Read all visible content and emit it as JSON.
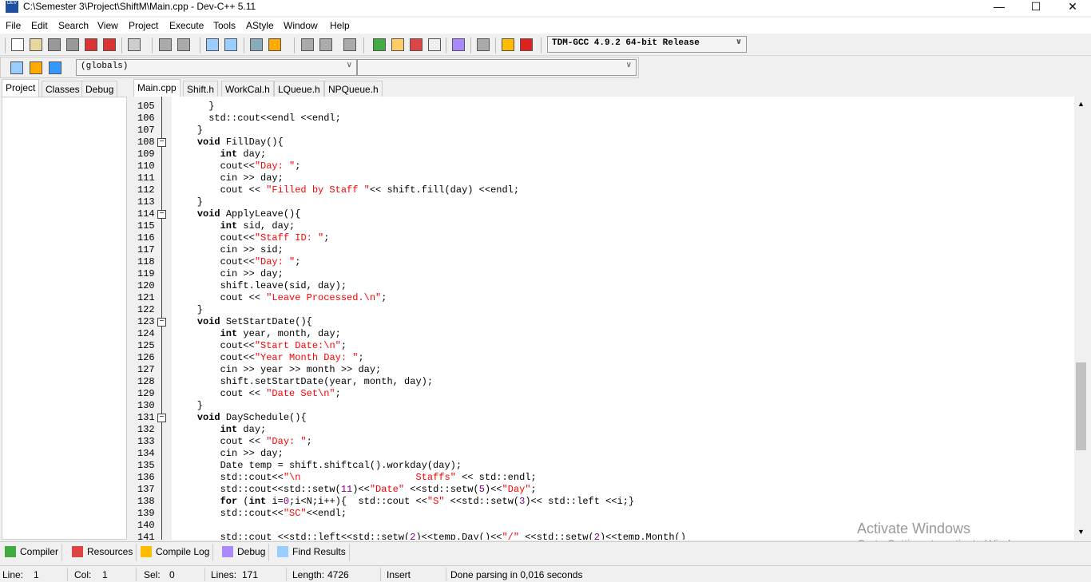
{
  "window": {
    "title": "C:\\Semester 3\\Project\\ShiftM\\Main.cpp - Dev-C++ 5.11",
    "icon_text": "DEV",
    "minimize": "—",
    "maximize": "☐",
    "close": "✕"
  },
  "menu": [
    "File",
    "Edit",
    "Search",
    "View",
    "Project",
    "Execute",
    "Tools",
    "AStyle",
    "Window",
    "Help"
  ],
  "toolbar": {
    "compiler_select": "TDM-GCC 4.9.2 64-bit Release",
    "scope_select": "(globals)",
    "member_select": ""
  },
  "left_tabs": [
    "Project",
    "Classes",
    "Debug"
  ],
  "file_tabs": [
    "Main.cpp",
    "Shift.h",
    "WorkCal.h",
    "LQueue.h",
    "NPQueue.h"
  ],
  "editor": {
    "first_line": 105,
    "fold_lines": [
      108,
      114,
      123,
      131
    ],
    "lines": [
      [
        [
          "t",
          "      }"
        ]
      ],
      [
        [
          "t",
          "      std::cout<<endl <<endl;"
        ]
      ],
      [
        [
          "t",
          "    }"
        ]
      ],
      [
        [
          "t",
          "    "
        ],
        [
          "kw",
          "void"
        ],
        [
          "t",
          " FillDay(){"
        ]
      ],
      [
        [
          "t",
          "        "
        ],
        [
          "kw",
          "int"
        ],
        [
          "t",
          " day;"
        ]
      ],
      [
        [
          "t",
          "        cout<<"
        ],
        [
          "str",
          "\"Day: \""
        ],
        [
          "t",
          ";"
        ]
      ],
      [
        [
          "t",
          "        cin >> day;"
        ]
      ],
      [
        [
          "t",
          "        cout << "
        ],
        [
          "str",
          "\"Filled by Staff \""
        ],
        [
          "t",
          "<< shift.fill(day) <<endl;"
        ]
      ],
      [
        [
          "t",
          "    }"
        ]
      ],
      [
        [
          "t",
          "    "
        ],
        [
          "kw",
          "void"
        ],
        [
          "t",
          " ApplyLeave(){"
        ]
      ],
      [
        [
          "t",
          "        "
        ],
        [
          "kw",
          "int"
        ],
        [
          "t",
          " sid, day;"
        ]
      ],
      [
        [
          "t",
          "        cout<<"
        ],
        [
          "str",
          "\"Staff ID: \""
        ],
        [
          "t",
          ";"
        ]
      ],
      [
        [
          "t",
          "        cin >> sid;"
        ]
      ],
      [
        [
          "t",
          "        cout<<"
        ],
        [
          "str",
          "\"Day: \""
        ],
        [
          "t",
          ";"
        ]
      ],
      [
        [
          "t",
          "        cin >> day;"
        ]
      ],
      [
        [
          "t",
          "        shift.leave(sid, day);"
        ]
      ],
      [
        [
          "t",
          "        cout << "
        ],
        [
          "str",
          "\"Leave Processed.\\n\""
        ],
        [
          "t",
          ";"
        ]
      ],
      [
        [
          "t",
          "    }"
        ]
      ],
      [
        [
          "t",
          "    "
        ],
        [
          "kw",
          "void"
        ],
        [
          "t",
          " SetStartDate(){"
        ]
      ],
      [
        [
          "t",
          "        "
        ],
        [
          "kw",
          "int"
        ],
        [
          "t",
          " year, month, day;"
        ]
      ],
      [
        [
          "t",
          "        cout<<"
        ],
        [
          "str",
          "\"Start Date:\\n\""
        ],
        [
          "t",
          ";"
        ]
      ],
      [
        [
          "t",
          "        cout<<"
        ],
        [
          "str",
          "\"Year Month Day: \""
        ],
        [
          "t",
          ";"
        ]
      ],
      [
        [
          "t",
          "        cin >> year >> month >> day;"
        ]
      ],
      [
        [
          "t",
          "        shift.setStartDate(year, month, day);"
        ]
      ],
      [
        [
          "t",
          "        cout << "
        ],
        [
          "str",
          "\"Date Set\\n\""
        ],
        [
          "t",
          ";"
        ]
      ],
      [
        [
          "t",
          "    }"
        ]
      ],
      [
        [
          "t",
          "    "
        ],
        [
          "kw",
          "void"
        ],
        [
          "t",
          " DaySchedule(){"
        ]
      ],
      [
        [
          "t",
          "        "
        ],
        [
          "kw",
          "int"
        ],
        [
          "t",
          " day;"
        ]
      ],
      [
        [
          "t",
          "        cout << "
        ],
        [
          "str",
          "\"Day: \""
        ],
        [
          "t",
          ";"
        ]
      ],
      [
        [
          "t",
          "        cin >> day;"
        ]
      ],
      [
        [
          "t",
          "        Date temp = shift.shiftcal().workday(day);"
        ]
      ],
      [
        [
          "t",
          "        std::cout<<"
        ],
        [
          "str",
          "\"\\n                    Staffs\""
        ],
        [
          "t",
          " << std::endl;"
        ]
      ],
      [
        [
          "t",
          "        std::cout<<std::setw("
        ],
        [
          "num",
          "11"
        ],
        [
          "t",
          ")<<"
        ],
        [
          "str",
          "\"Date\""
        ],
        [
          "t",
          " <<std::setw("
        ],
        [
          "num",
          "5"
        ],
        [
          "t",
          ")<<"
        ],
        [
          "str",
          "\"Day\""
        ],
        [
          "t",
          ";"
        ]
      ],
      [
        [
          "t",
          "        "
        ],
        [
          "kw",
          "for"
        ],
        [
          "t",
          " ("
        ],
        [
          "kw",
          "int"
        ],
        [
          "t",
          " i="
        ],
        [
          "num",
          "0"
        ],
        [
          "t",
          ";i<N;i++){  std::cout <<"
        ],
        [
          "str",
          "\"S\""
        ],
        [
          "t",
          " <<std::setw("
        ],
        [
          "num",
          "3"
        ],
        [
          "t",
          ")<< std::left <<i;}"
        ]
      ],
      [
        [
          "t",
          "        std::cout<<"
        ],
        [
          "str",
          "\"SC\""
        ],
        [
          "t",
          "<<endl;"
        ]
      ],
      [
        [
          "t",
          ""
        ]
      ],
      [
        [
          "t",
          "        std::cout <<std::left<<std::setw("
        ],
        [
          "num",
          "2"
        ],
        [
          "t",
          ")<<temp.Day()<<"
        ],
        [
          "str",
          "\"/\""
        ],
        [
          "t",
          " <<std::setw("
        ],
        [
          "num",
          "2"
        ],
        [
          "t",
          ")<<temp.Month()"
        ]
      ]
    ]
  },
  "bottom_tabs": [
    "Compiler",
    "Resources",
    "Compile Log",
    "Debug",
    "Find Results"
  ],
  "status": {
    "line_label": "Line:",
    "line": "1",
    "col_label": "Col:",
    "col": "1",
    "sel_label": "Sel:",
    "sel": "0",
    "lines_label": "Lines:",
    "lines": "171",
    "length_label": "Length:",
    "length": "4726",
    "mode": "Insert",
    "message": "Done parsing in 0,016 seconds"
  },
  "watermark": {
    "title": "Activate Windows",
    "subtitle": "Go to Settings to activate Windows."
  }
}
